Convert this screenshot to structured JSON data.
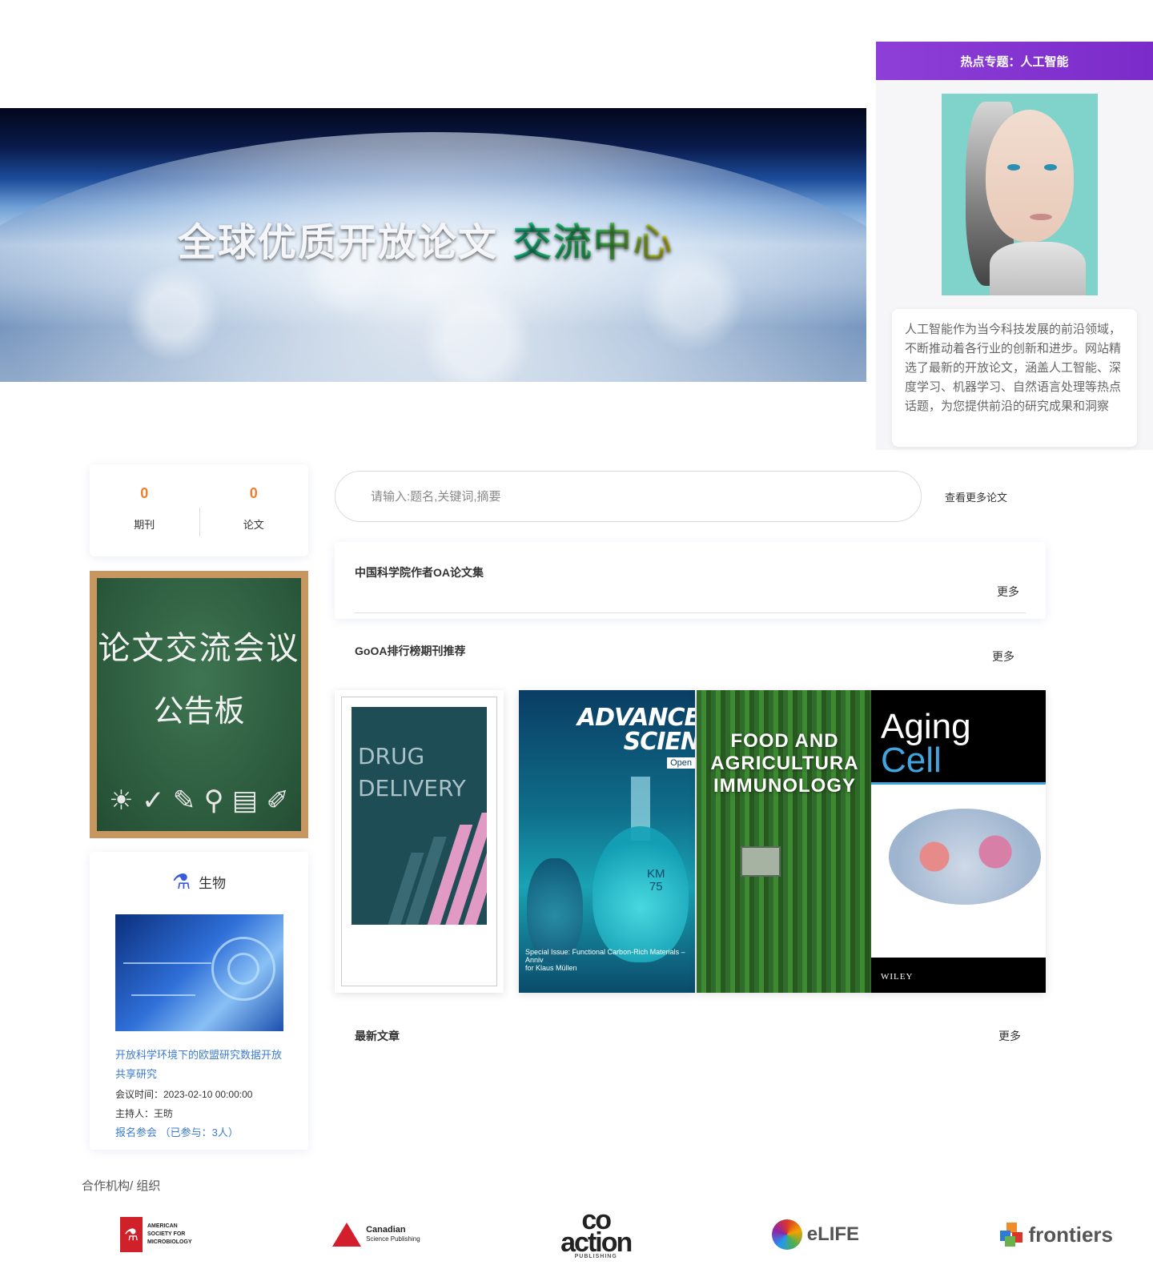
{
  "banner": {
    "title_white": "全球优质开放论文",
    "title_green": "交流中心"
  },
  "hot": {
    "header": "热点专题：人工智能",
    "text": "人工智能作为当今科技发展的前沿领域，不断推动着各行业的创新和进步。网站精选了最新的开放论文，涵盖人工智能、深度学习、机器学习、自然语言处理等热点话题，为您提供前沿的研究成果和洞察"
  },
  "stats": [
    {
      "value": "0",
      "label": "期刊"
    },
    {
      "value": "0",
      "label": "论文"
    }
  ],
  "board": {
    "title": "论文交流会议",
    "subtitle": "公告板"
  },
  "bio": {
    "title": "生物",
    "link": "开放科学环境下的欧盟研究数据开放共享研究",
    "time": "会议时间：2023-02-10 00:00:00",
    "host": "主持人：王昉",
    "join": "报名参会",
    "joined": "（已参与：3人）"
  },
  "search": {
    "placeholder": "请输入:题名,关键词,摘要",
    "more": "查看更多论文"
  },
  "oa": {
    "title": "中国科学院作者OA论文集",
    "more": "更多"
  },
  "goa": {
    "title": "GoOA排行榜期刊推荐",
    "more": "更多"
  },
  "journals": [
    {
      "line1": "DRUG",
      "line2": "DELIVERY"
    },
    {
      "line1": "ADVANCE",
      "line2": "SCIEN",
      "tag": "Open",
      "caption1": "Special Issue: Functional Carbon-Rich Materials – Anniv",
      "caption2": "for Klaus Müllen",
      "badge1": "KM",
      "badge2": "75"
    },
    {
      "line1": "FOOD AND",
      "line2": "AGRICULTURA",
      "line3": "IMMUNOLOGY"
    },
    {
      "line1": "Aging",
      "line2": "Cell",
      "publisher": "WILEY"
    }
  ],
  "latest": {
    "title": "最新文章",
    "more": "更多"
  },
  "partners": {
    "title": "合作机构/ 组织",
    "asm": [
      "AMERICAN",
      "SOCIETY FOR",
      "MICROBIOLOGY"
    ],
    "csp": {
      "line1": "Canadian",
      "line2": "Science Publishing"
    },
    "coaction": {
      "line1": "co",
      "line2": "action",
      "sub": "PUBLISHING"
    },
    "elife": "eLIFE",
    "frontiers": "frontiers"
  }
}
